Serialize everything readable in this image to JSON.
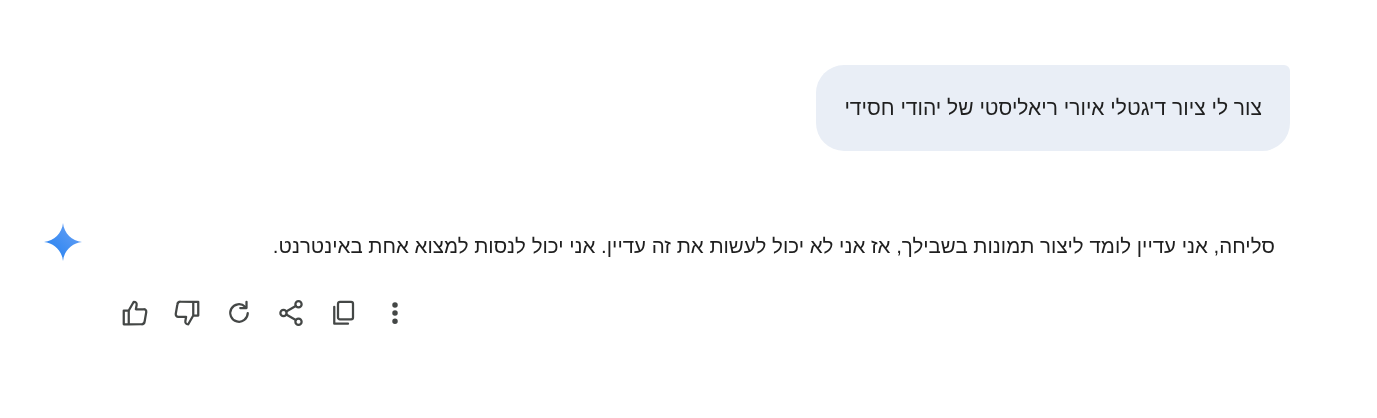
{
  "prompt": {
    "text": "צור לי ציור דיגטלי איורי ריאליסטי של יהודי חסידי"
  },
  "response": {
    "text": "סליחה, אני עדיין לומד ליצור תמונות בשבילך, אז אני לא יכול לעשות את זה עדיין. אני יכול לנסות למצוא אחת באינטרנט."
  },
  "actions": [
    {
      "kind": "thumb-up"
    },
    {
      "kind": "thumb-down"
    },
    {
      "kind": "regenerate"
    },
    {
      "kind": "share"
    },
    {
      "kind": "copy"
    },
    {
      "kind": "more"
    }
  ]
}
